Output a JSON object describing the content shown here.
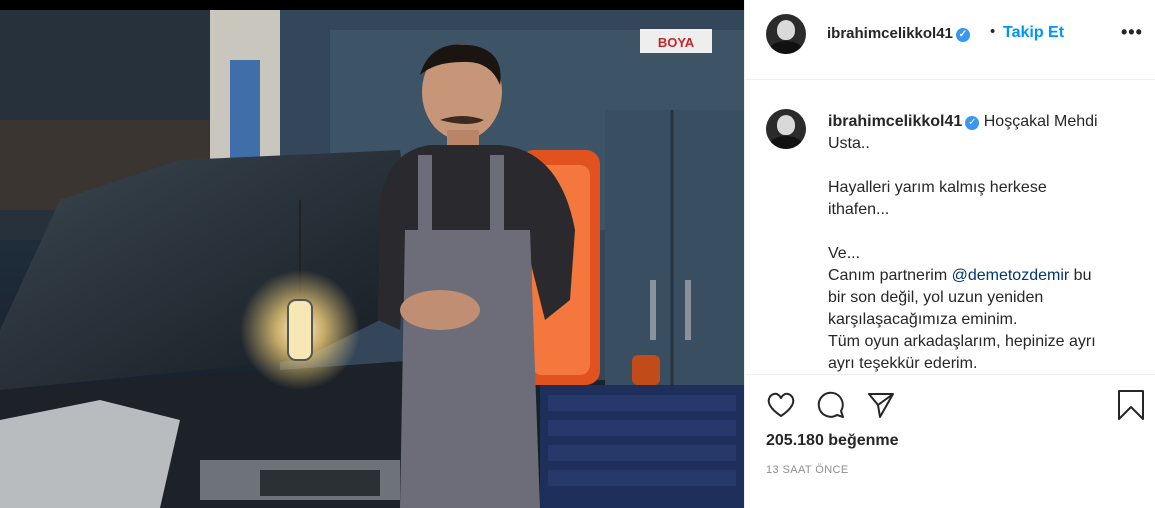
{
  "post": {
    "username": "ibrahimcelikkol41",
    "follow_label": "Takip Et",
    "separator": "•",
    "verified_mark": "✓",
    "more_label": "•••",
    "photo_sign": "BOYA"
  },
  "caption": {
    "username": "ibrahimcelikkol41",
    "line1": "Hoşçakal Mehdi Usta..",
    "para2_line1": "Hayalleri yarım kalmış herkese",
    "para2_line2": "ithafen...",
    "para3_line1": "Ve...",
    "para3_line2_pre": "Canım partnerim ",
    "mention": "@demetozdemir",
    "para3_line2_post": " bu",
    "para3_line3": "bir son değil, yol uzun yeniden",
    "para3_line4": "karşılaşacağımıza eminim.",
    "para3_line5": "Tüm oyun arkadaşlarım, hepinize ayrı",
    "para3_line6": "ayrı teşekkür ederim."
  },
  "actions": {
    "likes": "205.180 beğenme",
    "time": "13 SAAT ÖNCE"
  },
  "colors": {
    "accent": "#0095f6",
    "verified": "#3897f0",
    "mention": "#00376b"
  },
  "icons": [
    "heart-icon",
    "comment-icon",
    "share-icon",
    "bookmark-icon",
    "more-icon",
    "verified-icon"
  ]
}
